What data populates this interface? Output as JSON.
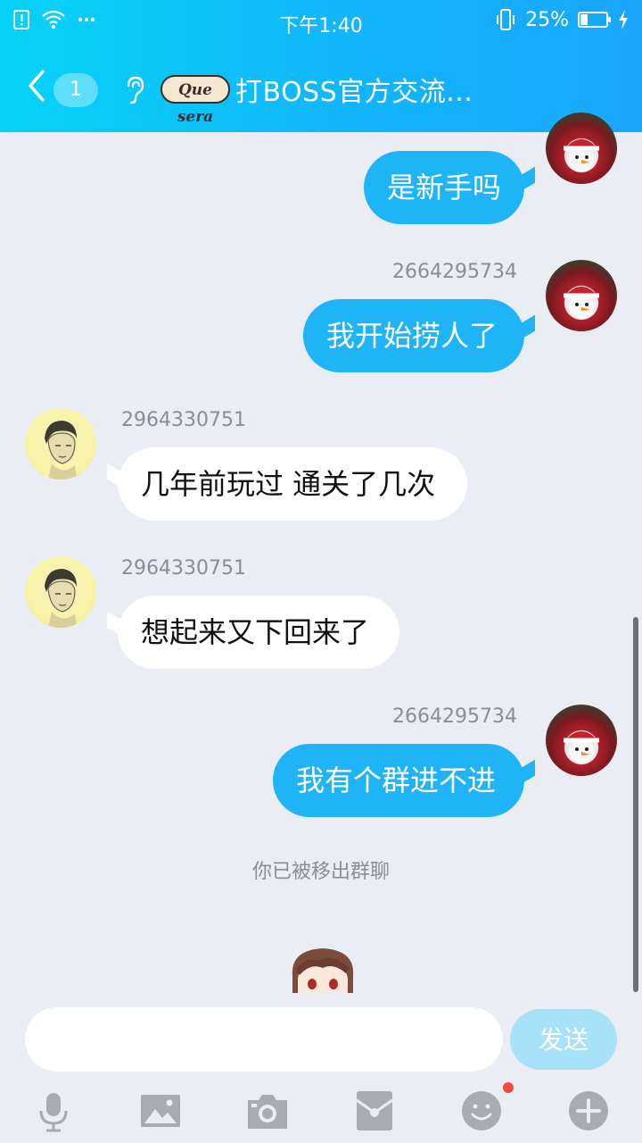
{
  "status_bar": {
    "time": "下午1:40",
    "battery": "25%"
  },
  "header": {
    "unread_count": "1",
    "logo_text": "Que sera",
    "group_title": "打BOSS官方交流..."
  },
  "messages": [
    {
      "side": "self",
      "sender": "",
      "text": "是新手吗"
    },
    {
      "side": "self",
      "sender": "2664295734",
      "text": "我开始捞人了"
    },
    {
      "side": "other",
      "sender": "2964330751",
      "text": "几年前玩过 通关了几次"
    },
    {
      "side": "other",
      "sender": "2964330751",
      "text": "想起来又下回来了"
    },
    {
      "side": "self",
      "sender": "2664295734",
      "text": "我有个群进不进"
    }
  ],
  "system_message": "你已被移出群聊",
  "input": {
    "value": "",
    "placeholder": "",
    "send_label": "发送"
  },
  "toolbar": {
    "items": [
      "microphone-icon",
      "image-icon",
      "camera-icon",
      "red-packet-icon",
      "emoji-icon",
      "plus-icon"
    ]
  },
  "colors": {
    "header_start": "#06d3f7",
    "header_end": "#1aa6fb",
    "self_bubble": "#1fb4f7",
    "other_bubble": "#ffffff",
    "background": "#ebedf5",
    "send_button": "#a7e2f9"
  }
}
